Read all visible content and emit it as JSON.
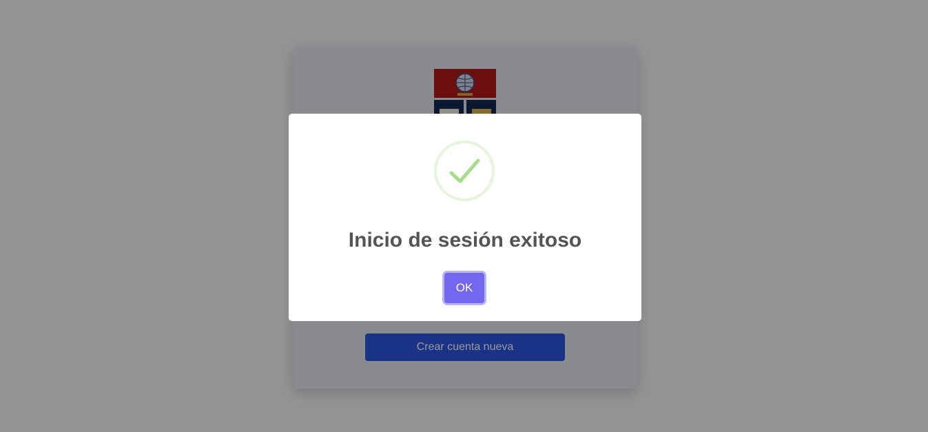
{
  "page": {
    "create_account_label": "Crear cuenta nueva",
    "logo_icon": "institution-crest-icon"
  },
  "modal": {
    "icon": "success-check-icon",
    "title": "Inicio de sesión exitoso",
    "confirm_label": "OK"
  },
  "colors": {
    "overlay": "rgba(0,0,0,0.4)",
    "confirm_button": "#7367f0",
    "success_icon": "#a5dc86",
    "create_button": "#2b55e0",
    "title_text": "#545454"
  }
}
